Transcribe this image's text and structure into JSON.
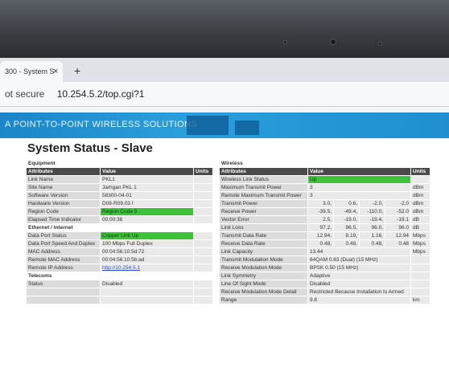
{
  "browser": {
    "tab_label": "300 - System S",
    "tab_close": "×",
    "new_tab": "+",
    "security": "ot secure",
    "url": "10.254.5.2/top.cgi?1"
  },
  "banner": {
    "text": "A POINT-TO-POINT WIRELESS SOLUTIONS"
  },
  "page_title": "System Status - Slave",
  "equipment": {
    "section": "Equipment",
    "headers": [
      "Attributes",
      "Value",
      "Units"
    ],
    "rows": [
      {
        "label": "Link Name",
        "value": "PKL1"
      },
      {
        "label": "Site Name",
        "value": "Jarhgan PKL 1"
      },
      {
        "label": "Software Version",
        "value": "58300-04-01"
      },
      {
        "label": "Hardware Version",
        "value": "D08-R09.03 I"
      },
      {
        "label": "Region Code",
        "value": "Region Code 5"
      },
      {
        "label": "Elapsed Time Indicator",
        "value": "00:00:36"
      }
    ],
    "ethernet_section": "Ethernet / Internet",
    "ethernet_rows": [
      {
        "label": "Data Port Status",
        "value": "Copper Link Up"
      },
      {
        "label": "Data Port Speed And Duplex",
        "value": "100 Mbps Full Duplex"
      },
      {
        "label": "MAC Address",
        "value": "00:04:56:10:5d:72"
      },
      {
        "label": "Remote MAC Address",
        "value": "00:04:56:10:5b:ad"
      },
      {
        "label": "Remote IP Address",
        "value": "http://10.254.5.1"
      }
    ],
    "telecoms_section": "Telecoms",
    "telecom_rows": [
      {
        "label": "Status",
        "value": "Disabled"
      }
    ]
  },
  "wireless": {
    "section": "Wireless",
    "headers": [
      "Attributes",
      "Value",
      "Units"
    ],
    "rows": [
      {
        "label": "Wireless Link Status",
        "v": [
          "Up"
        ],
        "u": ""
      },
      {
        "label": "Maximum Transmit Power",
        "v": [
          "3"
        ],
        "u": "dBm"
      },
      {
        "label": "Remote Maximum Transmit Power",
        "v": [
          "3"
        ],
        "u": "dBm"
      },
      {
        "label": "Transmit Power",
        "v": [
          "3.0,",
          "0.6,",
          "-2.0,",
          "-2.0"
        ],
        "u": "dBm"
      },
      {
        "label": "Receive Power",
        "v": [
          "-39.5,",
          "-49.4,",
          "-110.0,",
          "-52.0"
        ],
        "u": "dBm"
      },
      {
        "label": "Vector Error",
        "v": [
          "2.5,",
          "-19.0,",
          "-19.4,",
          "-19.1"
        ],
        "u": "dB"
      },
      {
        "label": "Link Loss",
        "v": [
          "97.2,",
          "96.5,",
          "96.0,",
          "96.0"
        ],
        "u": "dB"
      },
      {
        "label": "Transmit Data Rate",
        "v": [
          "12.94,",
          "8.19,",
          "1.16,",
          "12.94"
        ],
        "u": "Mbps"
      },
      {
        "label": "Receive Data Rate",
        "v": [
          "0.48,",
          "0.48,",
          "0.48,",
          "0.48"
        ],
        "u": "Mbps"
      },
      {
        "label": "Link Capacity",
        "v": [
          "13.44"
        ],
        "u": "Mbps"
      },
      {
        "label": "Transmit Modulation Mode",
        "v": [
          "64QAM 0.83 (Dual) (15 MHz)"
        ],
        "u": ""
      },
      {
        "label": "Receive Modulation Mode",
        "v": [
          "BPSK 0.50 (15 MHz)"
        ],
        "u": ""
      },
      {
        "label": "Link Symmetry",
        "v": [
          "Adaptive"
        ],
        "u": ""
      },
      {
        "label": "Line Of Sight Mode",
        "v": [
          "Disabled"
        ],
        "u": ""
      },
      {
        "label": "Receive Modulation Mode Detail",
        "v": [
          "Restricted Because Installation Is Armed"
        ],
        "u": ""
      },
      {
        "label": "Range",
        "v": [
          "9.8"
        ],
        "u": "km"
      }
    ]
  }
}
